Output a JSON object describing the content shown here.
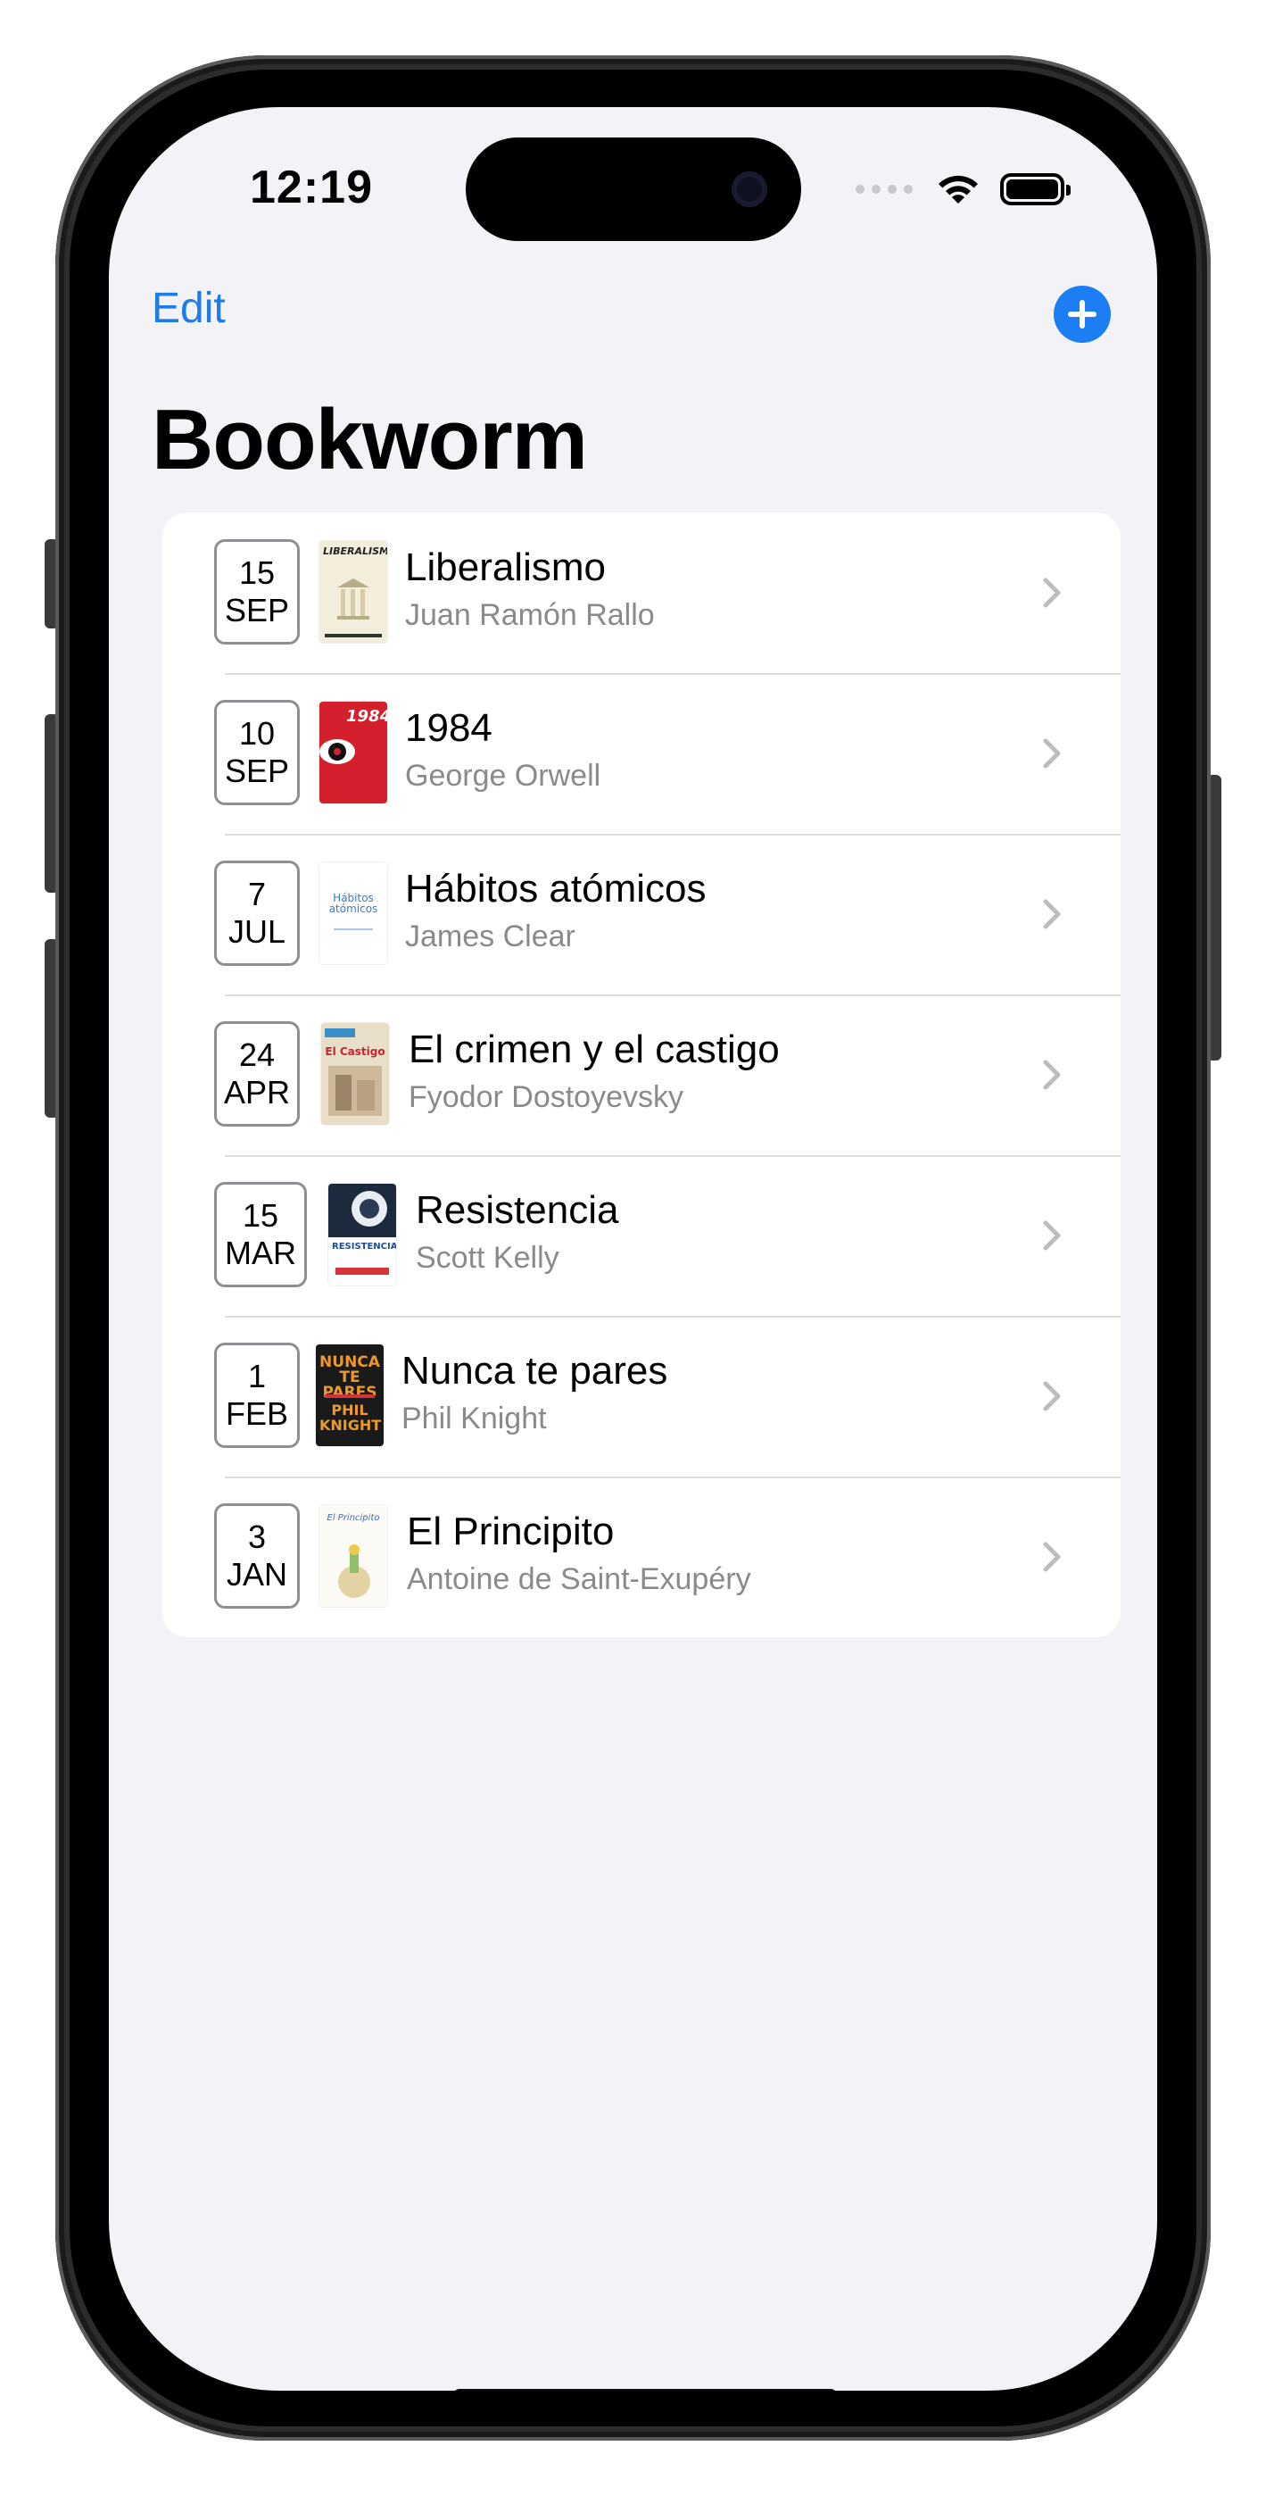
{
  "status_bar": {
    "time": "12:19",
    "icons": [
      "cellular-signal-icon",
      "wifi-icon",
      "battery-icon"
    ]
  },
  "nav": {
    "edit_label": "Edit",
    "add_icon": "plus-circle-icon",
    "title": "Bookworm"
  },
  "colors": {
    "accent": "#1d7ce8",
    "background": "#f2f2f7",
    "secondary_text": "#8a8a8e"
  },
  "books": [
    {
      "day": "15",
      "month": "SEP",
      "title": "Liberalismo",
      "author": "Juan Ramón Rallo",
      "cover_text": "LIBERALISMO"
    },
    {
      "day": "10",
      "month": "SEP",
      "title": "1984",
      "author": "George Orwell",
      "cover_text": "1984"
    },
    {
      "day": "7",
      "month": "JUL",
      "title": "Hábitos atómicos",
      "author": "James Clear",
      "cover_text": "Hábitos atómicos"
    },
    {
      "day": "24",
      "month": "APR",
      "title": "El crimen y el castigo",
      "author": "Fyodor Dostoyevsky",
      "cover_text": "El Castigo"
    },
    {
      "day": "15",
      "month": "MAR",
      "title": "Resistencia",
      "author": "Scott Kelly",
      "cover_text": "RESISTENCIA"
    },
    {
      "day": "1",
      "month": "FEB",
      "title": "Nunca te pares",
      "author": "Phil Knight",
      "cover_text": "NUNCA TE PARES"
    },
    {
      "day": "3",
      "month": "JAN",
      "title": "El Principito",
      "author": "Antoine de Saint-Exupéry",
      "cover_text": "El Principito"
    }
  ]
}
